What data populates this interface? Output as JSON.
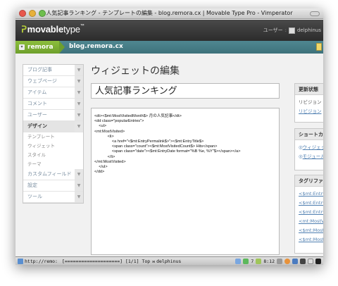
{
  "window": {
    "title": "人気記事ランキング - テンプレートの編集 - blog.remora.cx | Movable Type Pro - Vimperator"
  },
  "header": {
    "logo_text_bold": "movable",
    "logo_text_light": "type",
    "logo_tm": "™",
    "user_label": "ユーザー",
    "user_sep": ":",
    "user_name": "delphinus"
  },
  "blogbar": {
    "site_name": "remora",
    "blog_name": "blog.remora.cx"
  },
  "sidebar": {
    "items": [
      {
        "label": "ブログ記事"
      },
      {
        "label": "ウェブページ"
      },
      {
        "label": "アイテム"
      },
      {
        "label": "コメント"
      },
      {
        "label": "ユーザー"
      },
      {
        "label": "デザイン"
      }
    ],
    "sub_items": [
      {
        "label": "テンプレート"
      },
      {
        "label": "ウィジェット"
      },
      {
        "label": "スタイル"
      },
      {
        "label": "テーマ"
      }
    ],
    "items_after": [
      {
        "label": "カスタムフィールド"
      },
      {
        "label": "設定"
      },
      {
        "label": "ツール"
      }
    ]
  },
  "main": {
    "page_title": "ウィジェットの編集",
    "widget_name": "人気記事ランキング",
    "code_lines": [
      "<dt><$mt:MostVisitedMonth$> 月の人気記事</dt>",
      "<dd class=\"popularEntries\">",
      "    <ul>",
      "<mt:MostVisited>",
      "            <li>",
      "                <a href=\"<$mt:EntryPermalink$>\"><$mt:EntryTitle$>",
      "                <span class=\"count\"><$mt:MostVisitedCount$> Hits</span>",
      "                <span class=\"date\"><$mt:EntryDate format=\"%B %e, %Y\"$></span></a>",
      "            </li>",
      "</mt:MostVisited>",
      "    </ul>",
      "</dd>"
    ]
  },
  "right_panel": {
    "update": {
      "title": "更新状態",
      "revision": "リビジョン",
      "revision_link": "リビジョン"
    },
    "shortcuts": {
      "title": "ショートカット",
      "links": [
        "ウィジェット",
        "モジュール"
      ]
    },
    "tags": {
      "title": "タグリファレンス",
      "links": [
        "<$mt:EntryPermalink$>",
        "<$mt:EntryTitle$>",
        "<$mt:EntryDate$>",
        "<mt:MostVisited>",
        "<$mt:MostVisitedCount$>",
        "<$mt:MostVisitedMonth$>"
      ]
    }
  },
  "statusbar": {
    "url": "http://remo:",
    "progress": "[====================] [1/1] Top",
    "user": "delphinus",
    "time": "8:12",
    "count": "7"
  }
}
